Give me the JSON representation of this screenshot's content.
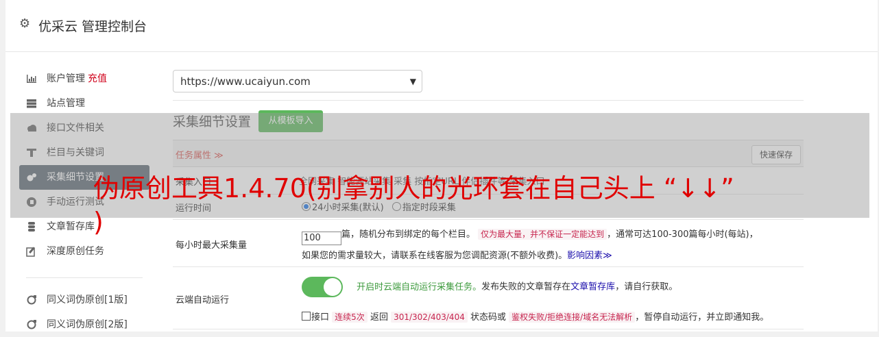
{
  "header": {
    "title": "优采云 管理控制台",
    "icon": "gear-icon"
  },
  "sidebar": {
    "items": [
      {
        "label": "账户管理",
        "extra": "充值",
        "icon": "bar-chart-icon"
      },
      {
        "label": "站点管理",
        "icon": "server-icon"
      },
      {
        "label": "接口文件相关",
        "icon": "cloud-upload-icon"
      },
      {
        "label": "栏目与关键词",
        "icon": "filter-icon"
      },
      {
        "label": "采集细节设置",
        "icon": "cogs-icon"
      },
      {
        "label": "手动运行测试",
        "icon": "play-circle-icon"
      },
      {
        "label": "文章暂存库",
        "icon": "database-icon"
      },
      {
        "label": "深度原创任务",
        "icon": "edit-icon"
      },
      {
        "label": "同义词伪原创[1版]",
        "icon": "refresh-icon"
      },
      {
        "label": "同义词伪原创[2版]",
        "icon": "refresh-icon"
      }
    ]
  },
  "main": {
    "site_select": "https://www.ucaiyun.com",
    "section_title": "采集细节设置",
    "import_button": "从模板导入",
    "task_attr": "任务属性 ≫",
    "save_button": "快速保存",
    "rows": {
      "entry": {
        "label": "采集入口",
        "faint": "全网采集   智能源站采集   采集   按指定URL   伴侣插件等   采集入口"
      },
      "runtime": {
        "label": "运行时间",
        "opt1": "24小时采集(默认)",
        "opt2": "指定时段采集"
      },
      "max": {
        "label": "每小时最大采集量",
        "value": "100",
        "t1": "篇，随机分布到绑定的每个栏目。",
        "tag": "仅为最大量，并不保证一定能达到",
        "t2": "，通常可达100-300篇每小时(每站)，",
        "t3": "如果您的需求量较大，请联系在线客服为您调配资源(不额外收费)。",
        "link": "影响因素≫"
      },
      "cloud": {
        "label": "云端自动运行",
        "t1": "开启时云端自动运行采集任务。",
        "t2": "发布失败的文章暂存在",
        "link": "文章暂存库",
        "t3": "，请自行获取。",
        "cb_label": "接口",
        "tag1": "连续5次",
        "t4": "返回",
        "tag2": "301/302/403/404",
        "t5": "状态码或",
        "tag3": "鉴权失败/拒绝连接/域名无法解析",
        "t6": "，暂停自动运行，并立即通知我。"
      }
    }
  },
  "watermark": {
    "line1": "伪原创工具1.4.70(别拿别人的光环套在自己头上 “↓↓”",
    "line2": ")"
  }
}
